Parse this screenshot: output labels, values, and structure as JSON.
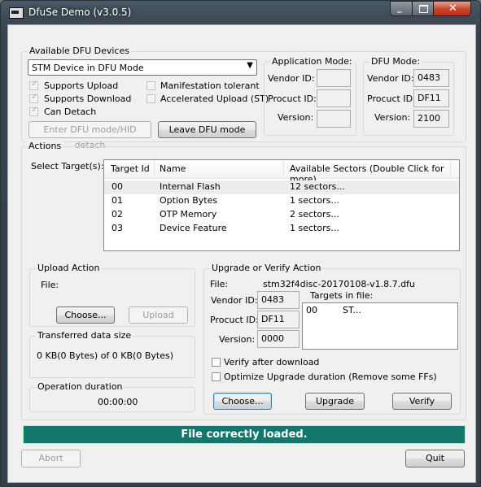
{
  "window": {
    "title": "DfuSe Demo (v3.0.5)"
  },
  "available_devices": {
    "legend": "Available DFU Devices",
    "selected_device": "STM Device in DFU Mode",
    "chk_upload": "Supports Upload",
    "chk_download": "Supports Download",
    "chk_detach": "Can Detach",
    "chk_manifest": "Manifestation tolerant",
    "chk_accel": "Accelerated Upload (ST)",
    "enter_dfu_btn": "Enter DFU mode/HID detach",
    "leave_dfu_btn": "Leave DFU mode"
  },
  "app_mode": {
    "legend": "Application Mode:",
    "vendor_label": "Vendor ID:",
    "product_label": "Procuct ID:",
    "version_label": "Version:",
    "vendor": "",
    "product": "",
    "version": ""
  },
  "dfu_mode": {
    "legend": "DFU Mode:",
    "vendor_label": "Vendor ID:",
    "product_label": "Procuct ID:",
    "version_label": "Version:",
    "vendor": "0483",
    "product": "DF11",
    "version": "2100"
  },
  "actions": {
    "legend": "Actions",
    "select_targets_label": "Select Target(s):",
    "columns": [
      "Target Id",
      "Name",
      "Available Sectors (Double Click for more)"
    ],
    "rows": [
      {
        "id": "00",
        "name": "Internal Flash",
        "sectors": "12 sectors..."
      },
      {
        "id": "01",
        "name": "Option Bytes",
        "sectors": "1 sectors..."
      },
      {
        "id": "02",
        "name": "OTP Memory",
        "sectors": "2 sectors..."
      },
      {
        "id": "03",
        "name": "Device Feature",
        "sectors": "1 sectors..."
      }
    ]
  },
  "upload_action": {
    "legend": "Upload Action",
    "file_label": "File:",
    "choose_btn": "Choose...",
    "upload_btn": "Upload"
  },
  "transferred": {
    "legend": "Transferred data size",
    "value": "0 KB(0 Bytes) of 0 KB(0 Bytes)"
  },
  "duration": {
    "legend": "Operation duration",
    "value": "00:00:00"
  },
  "upgrade_verify": {
    "legend": "Upgrade or Verify Action",
    "file_label": "File:",
    "file_name": "stm32f4disc-20170108-v1.8.7.dfu",
    "vendor_label": "Vendor ID:",
    "product_label": "Procuct ID:",
    "version_label": "Version:",
    "vendor": "0483",
    "product": "DF11",
    "version": "0000",
    "targets_label": "Targets in file:",
    "targets": [
      {
        "id": "00",
        "name": "ST..."
      }
    ],
    "chk_verify": "Verify after download",
    "chk_optimize": "Optimize Upgrade duration (Remove some FFs)",
    "choose_btn": "Choose...",
    "upgrade_btn": "Upgrade",
    "verify_btn": "Verify"
  },
  "status_text": "File correctly loaded.",
  "abort_btn": "Abort",
  "quit_btn": "Quit",
  "colors": {
    "status_bar": "#12786c",
    "title_bar": "#3f4c57",
    "close_button": "#c9432a"
  }
}
